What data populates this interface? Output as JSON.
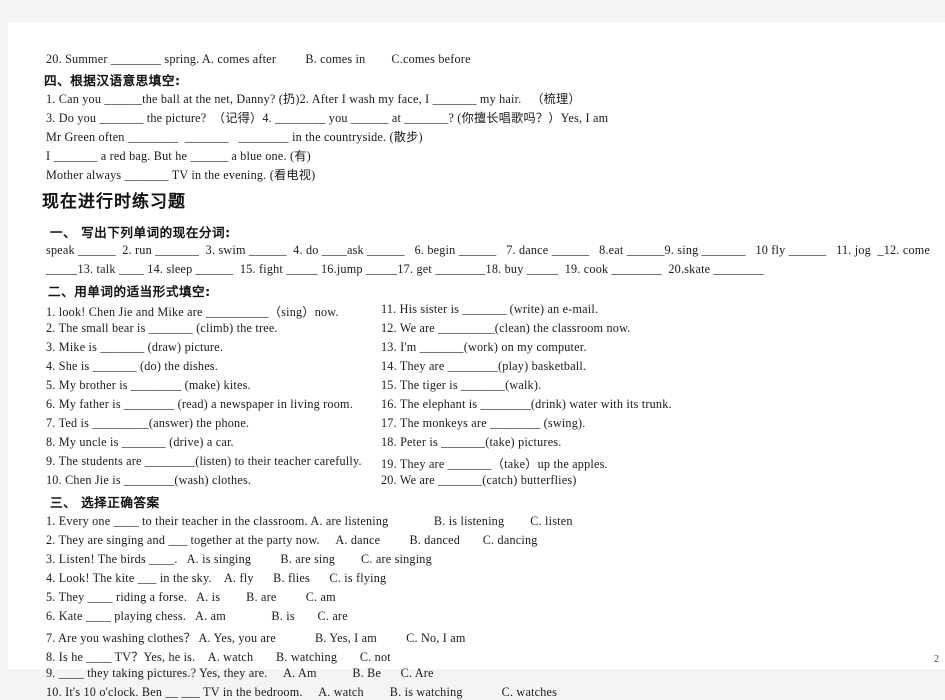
{
  "document": {
    "page_number": "2",
    "top_fragment": {
      "line": "20. Summer ________ spring. A. comes after         B. comes in        C.comes before"
    },
    "section_four": {
      "heading": "四、根据汉语意思填空:",
      "lines": [
        "1. Can you ______the ball at the net, Danny? (扔)2. After I wash my face, I _______ my hair.   （梳理）",
        "3. Do you _______ the picture?  （记得）4. ________ you ______ at _______? (你擅长唱歌吗？）Yes, I am",
        "Mr Green often ________  _______   ________ in the countryside. (散步)",
        "I _______ a red bag. But he ______ a blue one. (有)",
        "Mother always _______ TV in the evening. (看电视)"
      ]
    },
    "title": "现在进行时练习题",
    "section_one": {
      "heading": "一、 写出下列单词的现在分词:",
      "lines": [
        "speak ______  2. run _______  3. swim ______  4. do ____ask ______   6. begin ______   7. dance ______   8.eat ______9. sing _______   10 fly ______   11. jog  _12. come",
        "_____13. talk ____ 14. sleep ______  15. fight _____ 16.jump _____17. get ________18. buy _____  19. cook ________  20.skate ________"
      ]
    },
    "section_two": {
      "heading": "二、用单词的适当形式填空:",
      "left_items": [
        "1. look! Chen Jie and Mike are __________（sing）now.",
        "2. The small bear is _______ (climb) the tree.",
        "3. Mike is _______ (draw) picture.",
        "4. She is _______ (do) the dishes.",
        "5. My brother is ________ (make) kites.",
        "6. My father is ________ (read) a newspaper in living room.",
        "7. Ted is _________(answer) the phone.",
        "8. My uncle is _______ (drive) a car.",
        "9. The students are ________(listen) to their teacher carefully.",
        "10. Chen Jie is ________(wash) clothes."
      ],
      "right_items": [
        "11. His sister is _______ (write) an e-mail.",
        "12. We are _________(clean) the classroom now.",
        "13. I'm _______(work) on my computer.",
        "14. They are ________(play) basketball.",
        "15. The tiger is _______(walk).",
        "16. The elephant is ________(drink) water with its trunk.",
        "17. The monkeys are ________ (swing).",
        "18. Peter is _______(take) pictures.",
        "19. They are _______（take）up the apples.",
        "20. We are _______(catch) butterflies)"
      ]
    },
    "section_three": {
      "heading": "三、 选择正确答案",
      "items": [
        "1. Every one ____ to their teacher in the classroom. A. are listening              B. is listening        C. listen",
        "2. They are singing and ___ together at the party now.     A. dance         B. danced       C. dancing",
        "3. Listen! The birds ____.   A. is singing         B. are sing        C. are singing",
        "4. Look! The kite ___ in the sky.    A. fly      B. flies      C. is flying",
        "5. They ____ riding a forse.   A. is        B. are         C. am",
        "6. Kate ____ playing chess.   A. am              B. is       C. are",
        "7. Are you washing clothes？ A. Yes, you are            B. Yes, I am         C. No, I am",
        "8. Is he ____ TV？Yes, he is.    A. watch       B. watching       C. not",
        "9. ____ they taking pictures.? Yes, they are.     A. Am           B. Be      C. Are",
        "10. It's 10 o'clock. Ben __ ___ TV in the bedroom.     A. watch        B. is watching            C. watches"
      ]
    }
  }
}
